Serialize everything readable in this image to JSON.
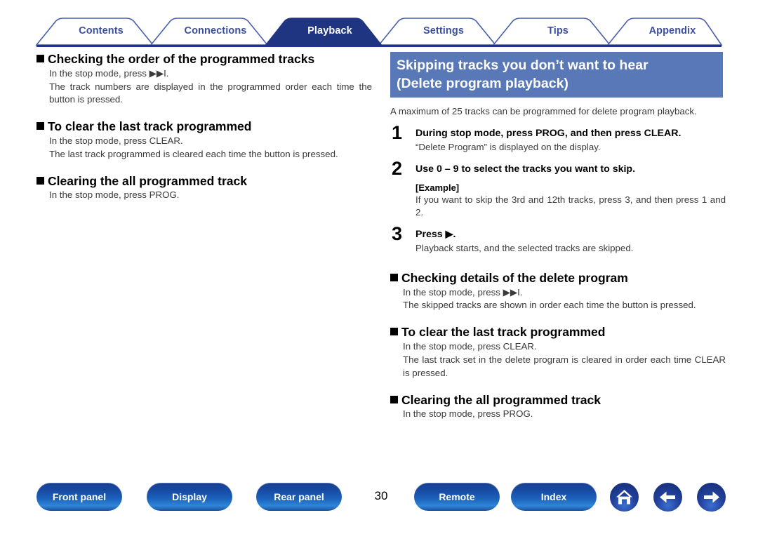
{
  "tabs": [
    {
      "label": "Contents",
      "active": false
    },
    {
      "label": "Connections",
      "active": false
    },
    {
      "label": "Playback",
      "active": true
    },
    {
      "label": "Settings",
      "active": false
    },
    {
      "label": "Tips",
      "active": false
    },
    {
      "label": "Appendix",
      "active": false
    }
  ],
  "colors": {
    "tab_active_bg": "#1f3582",
    "tab_inactive_text": "#3b4fa0",
    "tab_border": "#4a5fae",
    "rule": "#1f3582",
    "banner_bg": "#5878b8",
    "button_blue": "#1b4fa6"
  },
  "left_column": {
    "sections": [
      {
        "heading": "Checking the order of the programmed tracks",
        "lines": [
          "In the stop mode, press ▶▶I.",
          "The track numbers are displayed in the programmed order each time the button is pressed."
        ]
      },
      {
        "heading": "To clear the last track programmed",
        "lines": [
          "In the stop mode, press CLEAR.",
          "The last track programmed is cleared each time the button is pressed."
        ]
      },
      {
        "heading": "Clearing the all programmed track",
        "lines": [
          "In the stop mode, press PROG."
        ]
      }
    ]
  },
  "right_column": {
    "banner": {
      "line1": "Skipping tracks you don’t want to hear",
      "line2": "(Delete program playback)"
    },
    "intro": "A maximum of 25 tracks can be programmed for delete program playback.",
    "steps": [
      {
        "number": "1",
        "title": "During stop mode, press PROG, and then press CLEAR.",
        "text": "“Delete Program” is displayed on the display."
      },
      {
        "number": "2",
        "title": "Use 0 – 9 to select the tracks you want to skip.",
        "example_label": "[Example]",
        "text": "If you want to skip the 3rd and 12th tracks, press 3, and then press 1 and 2."
      },
      {
        "number": "3",
        "title": "Press ▶.",
        "text": "Playback starts, and the selected tracks are skipped."
      }
    ],
    "sections": [
      {
        "heading": "Checking details of the delete program",
        "lines": [
          "In the stop mode, press ▶▶I.",
          "The skipped tracks are shown in order each time the button is pressed."
        ]
      },
      {
        "heading": "To clear the last track programmed",
        "lines": [
          "In the stop mode, press CLEAR.",
          "The last track set in the delete program is cleared in order each time CLEAR is pressed."
        ]
      },
      {
        "heading": "Clearing the all programmed track",
        "lines": [
          "In the stop mode, press PROG."
        ]
      }
    ]
  },
  "footer": {
    "buttons": [
      {
        "label": "Front panel"
      },
      {
        "label": "Display"
      },
      {
        "label": "Rear panel"
      },
      {
        "label": "Remote"
      },
      {
        "label": "Index"
      }
    ],
    "page_number": "30",
    "icons": [
      {
        "name": "home-icon"
      },
      {
        "name": "arrow-left-icon"
      },
      {
        "name": "arrow-right-icon"
      }
    ]
  }
}
